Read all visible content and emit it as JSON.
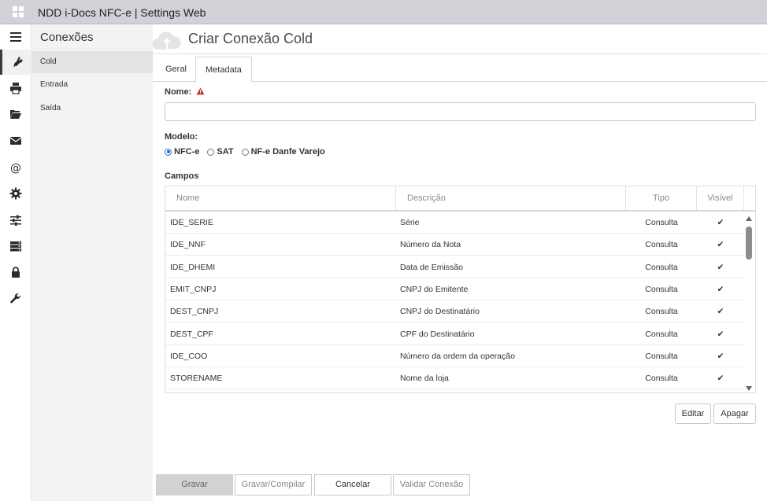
{
  "window": {
    "title": "NDD i-Docs NFC-e | Settings Web"
  },
  "iconbar": {
    "items": [
      {
        "name": "hamburger-menu-icon"
      },
      {
        "name": "plug-icon"
      },
      {
        "name": "printer-icon"
      },
      {
        "name": "folder-open-icon"
      },
      {
        "name": "envelope-icon"
      },
      {
        "name": "at-sign-icon"
      },
      {
        "name": "gear-icon"
      },
      {
        "name": "sliders-icon"
      },
      {
        "name": "server-icon"
      },
      {
        "name": "lock-icon"
      },
      {
        "name": "wrench-icon"
      }
    ]
  },
  "submenu": {
    "title": "Conexões",
    "items": [
      {
        "label": "Cold",
        "active": true
      },
      {
        "label": "Entrada",
        "active": false
      },
      {
        "label": "Saída",
        "active": false
      }
    ]
  },
  "page": {
    "title": "Criar Conexão Cold"
  },
  "tabs": [
    {
      "label": "Geral",
      "active": false
    },
    {
      "label": "Metadata",
      "active": true
    }
  ],
  "form": {
    "name_label": "Nome:",
    "name_value": "",
    "modelo_label": "Modelo:",
    "modelo_options": [
      {
        "label": "NFC-e",
        "selected": true
      },
      {
        "label": "SAT",
        "selected": false
      },
      {
        "label": "NF-e Danfe Varejo",
        "selected": false
      }
    ],
    "campos_label": "Campos"
  },
  "grid": {
    "columns": [
      "Nome",
      "Descrição",
      "Tipo",
      "Visível"
    ],
    "rows": [
      {
        "nome": "IDE_SERIE",
        "descricao": "Série",
        "tipo": "Consulta",
        "visivel": "✔"
      },
      {
        "nome": "IDE_NNF",
        "descricao": "Número da Nota",
        "tipo": "Consulta",
        "visivel": "✔"
      },
      {
        "nome": "IDE_DHEMI",
        "descricao": "Data de Emissão",
        "tipo": "Consulta",
        "visivel": "✔"
      },
      {
        "nome": "EMIT_CNPJ",
        "descricao": "CNPJ do Emitente",
        "tipo": "Consulta",
        "visivel": "✔"
      },
      {
        "nome": "DEST_CNPJ",
        "descricao": "CNPJ do Destinatário",
        "tipo": "Consulta",
        "visivel": "✔"
      },
      {
        "nome": "DEST_CPF",
        "descricao": "CPF do Destinatário",
        "tipo": "Consulta",
        "visivel": "✔"
      },
      {
        "nome": "IDE_COO",
        "descricao": "Número da ordem da operação",
        "tipo": "Consulta",
        "visivel": "✔"
      },
      {
        "nome": "STORENAME",
        "descricao": "Nome da loja",
        "tipo": "Consulta",
        "visivel": "✔"
      }
    ],
    "edit_label": "Editar",
    "delete_label": "Apagar"
  },
  "footer": {
    "save_label": "Gravar",
    "save_compile_label": "Gravar/Compilar",
    "cancel_label": "Cancelar",
    "validate_label": "Validar Conexão"
  },
  "colors": {
    "accent": "#1f6fd1",
    "titlebar": "#d3d0d8",
    "warning": "#c0392b"
  }
}
